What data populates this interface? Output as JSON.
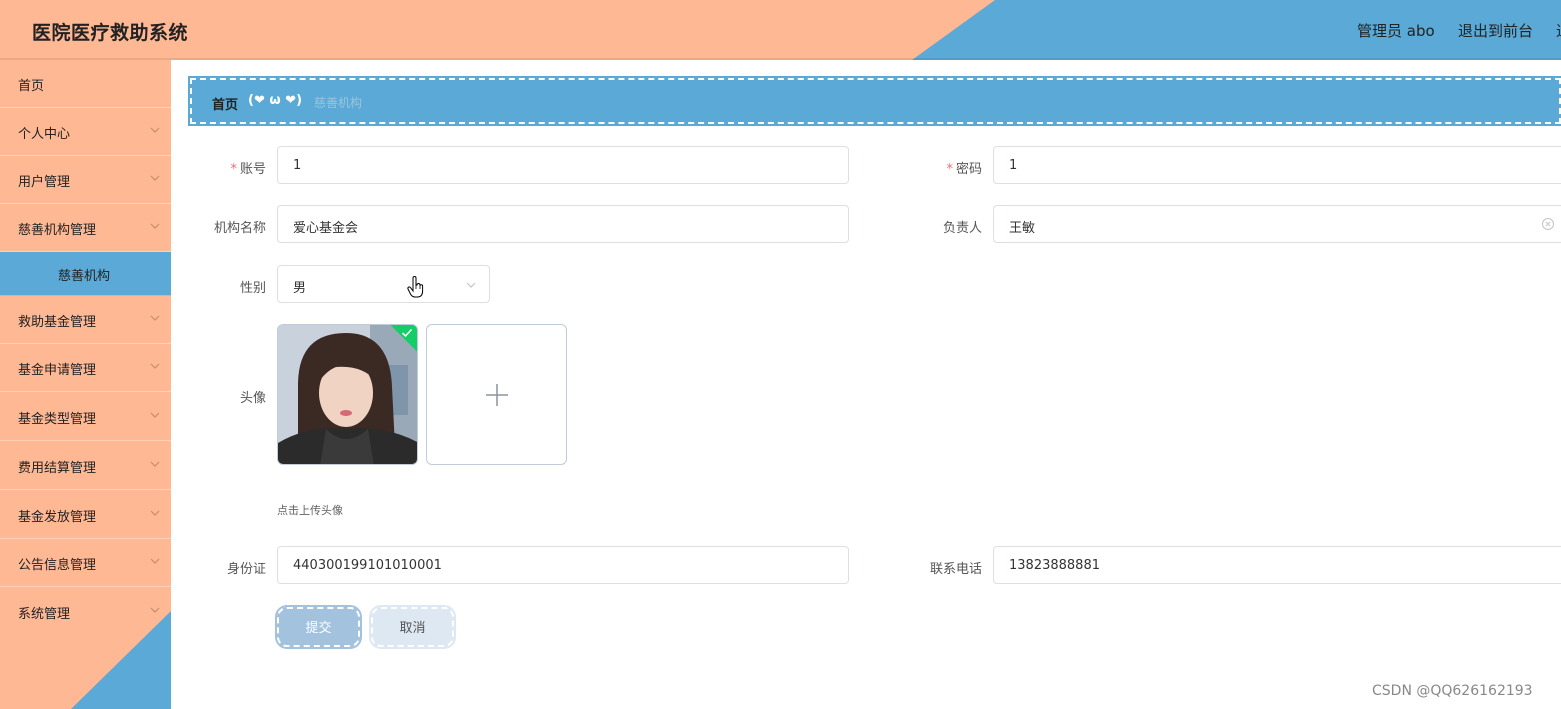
{
  "header": {
    "title": "医院医疗救助系统",
    "admin": "管理员 abo",
    "exit": "退出到前台",
    "cut": "退"
  },
  "sidebar": {
    "items": [
      {
        "label": "首页"
      },
      {
        "label": "个人中心"
      },
      {
        "label": "用户管理"
      },
      {
        "label": "慈善机构管理"
      },
      {
        "label": "慈善机构"
      },
      {
        "label": "救助基金管理"
      },
      {
        "label": "基金申请管理"
      },
      {
        "label": "基金类型管理"
      },
      {
        "label": "费用结算管理"
      },
      {
        "label": "基金发放管理"
      },
      {
        "label": "公告信息管理"
      },
      {
        "label": "系统管理"
      }
    ]
  },
  "breadcrumb": {
    "home": "首页",
    "face": "(❤ ω ❤)",
    "current": "慈善机构"
  },
  "form": {
    "account_label": "账号",
    "account_value": "1",
    "password_label": "密码",
    "password_value": "1",
    "org_label": "机构名称",
    "org_value": "爱心基金会",
    "leader_label": "负责人",
    "leader_value": "王敏",
    "gender_label": "性别",
    "gender_value": "男",
    "avatar_label": "头像",
    "upload_hint": "点击上传头像",
    "idcard_label": "身份证",
    "idcard_value": "440300199101010001",
    "phone_label": "联系电话",
    "phone_value": "13823888881",
    "required_mark": "*"
  },
  "buttons": {
    "submit": "提交",
    "cancel": "取消"
  },
  "watermark": "CSDN @QQ626162193",
  "colors": {
    "peach": "#ffb894",
    "blue": "#5aa9d6",
    "success": "#13ce66"
  }
}
